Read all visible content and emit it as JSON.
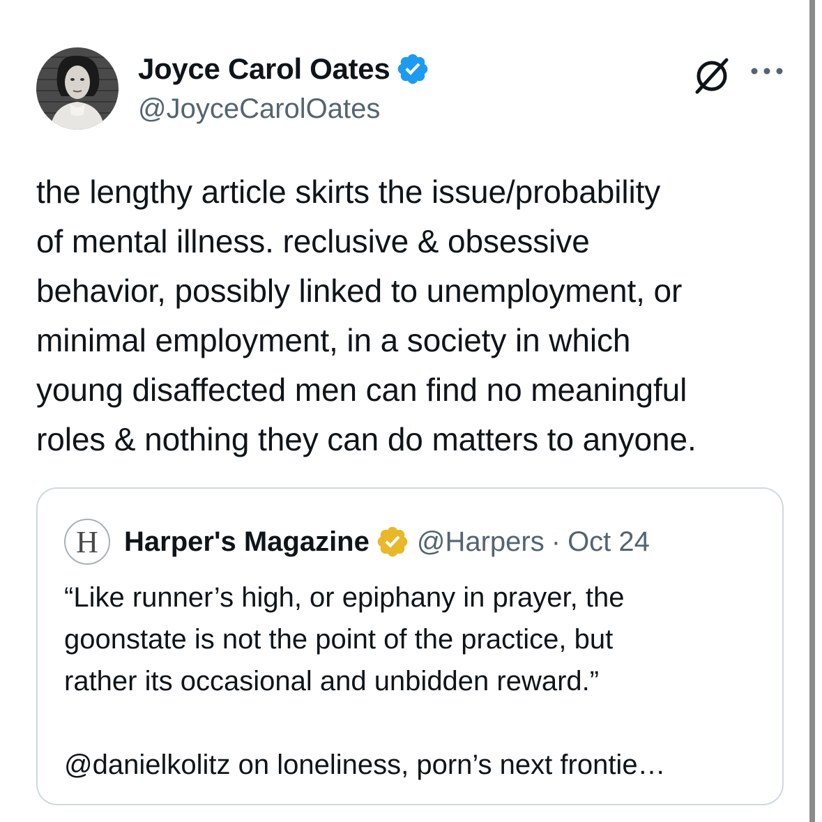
{
  "tweet": {
    "author_name": "Joyce Carol Oates",
    "author_handle": "@JoyceCarolOates",
    "verified_color": "#1d9bf0",
    "text": "the lengthy article skirts the issue/probability\nof mental illness. reclusive & obsessive\nbehavior, possibly linked to unemployment, or\nminimal employment, in a society in which\nyoung disaffected men can find no meaningful\nroles & nothing they can do matters to anyone.",
    "icons": [
      "grok-icon",
      "more-icon",
      "verified-badge-icon"
    ]
  },
  "quote": {
    "logo_letter": "H",
    "name": "Harper's Magazine",
    "handle": "@Harpers",
    "separator": "·",
    "date": "Oct 24",
    "verified_color": "#e8b829",
    "text": "“Like runner’s high, or epiphany in prayer, the\ngoonstate is not the point of the practice, but\nrather its occasional and unbidden reward.”\n\n@danielkolitz on loneliness, porn’s next frontie…"
  }
}
